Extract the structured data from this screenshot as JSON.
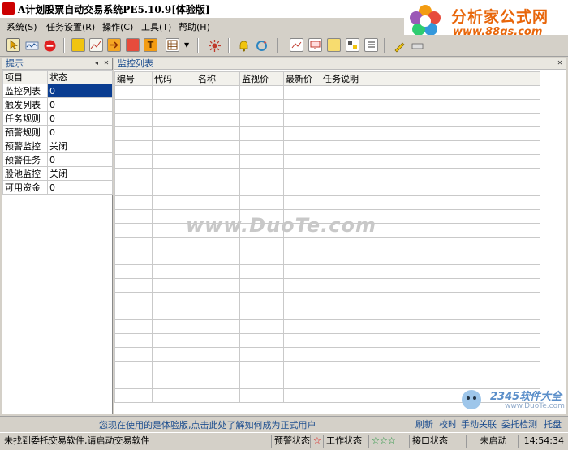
{
  "window": {
    "title": "A计划股票自动交易系统PE5.10.9[体验版]"
  },
  "logo": {
    "brand": "分析家公式网",
    "url": "www.88gs.com"
  },
  "menu": [
    {
      "label": "系统(S)"
    },
    {
      "label": "任务设置(R)"
    },
    {
      "label": "操作(C)"
    },
    {
      "label": "工具(T)"
    },
    {
      "label": "帮助(H)"
    }
  ],
  "toolbar": {
    "icons": [
      "pointer-icon",
      "wave-chart-icon",
      "stop-icon",
      "b-icon",
      "line-chart-icon",
      "arrow-right-icon",
      "edit-icon",
      "t-icon",
      "table-icon",
      "dropdown-icon",
      "settings-icon",
      "bell-icon",
      "refresh-icon",
      "chart-icon",
      "monitor-icon",
      "calc-icon",
      "group-icon",
      "list-icon",
      "pen-icon",
      "keyboard-icon"
    ]
  },
  "left_panel": {
    "header": "提示",
    "columns": [
      "项目",
      "状态"
    ],
    "rows": [
      {
        "item": "监控列表",
        "status": "0"
      },
      {
        "item": "触发列表",
        "status": "0"
      },
      {
        "item": "任务规则",
        "status": "0"
      },
      {
        "item": "预警规则",
        "status": "0"
      },
      {
        "item": "预警监控",
        "status": "关闭"
      },
      {
        "item": "预警任务",
        "status": "0"
      },
      {
        "item": "股池监控",
        "status": "关闭"
      },
      {
        "item": "可用资金",
        "status": "0"
      }
    ]
  },
  "right_panel": {
    "header": "监控列表",
    "columns": [
      "编号",
      "代码",
      "名称",
      "监视价",
      "最新价",
      "任务说明"
    ]
  },
  "watermark": {
    "main": "www.DuoTe.com",
    "corner_brand": "2345软件大全",
    "corner_url": "www.DuoTe.com"
  },
  "notice_bar": {
    "message": "您现在使用的是体验版,点击此处了解如何成为正式用户",
    "buttons": [
      "刷新",
      "校时",
      "手动关联",
      "委托检测",
      "托盘"
    ]
  },
  "status_bar": {
    "message": "未找到委托交易软件,请启动交易软件",
    "alert_status_label": "预警状态",
    "work_status_label": "工作状态",
    "stars": "☆☆☆",
    "interface_status_label": "接口状态",
    "start_state": "未启动",
    "time": "14:54:34"
  }
}
